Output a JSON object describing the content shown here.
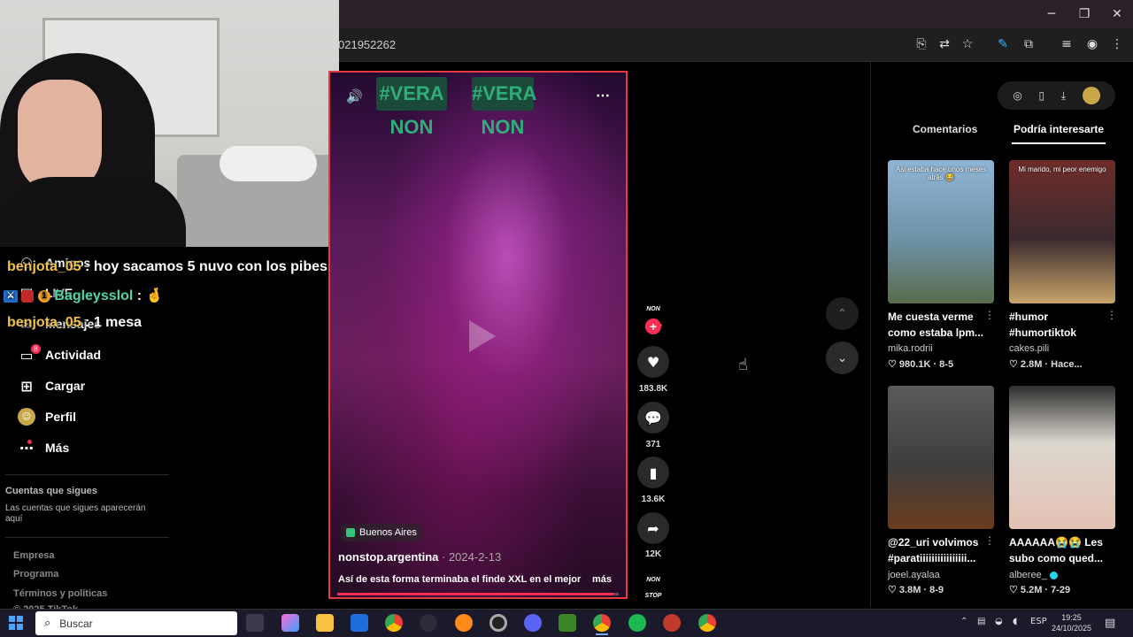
{
  "browser": {
    "url_fragment": "021952262",
    "window_controls": {
      "minimize": "─",
      "restore": "❐",
      "close": "✕"
    }
  },
  "chat_overlay": [
    {
      "user": "benjota_05",
      "sep": " : ",
      "text": "hoy sacamos 5 nuvo con los pibes"
    },
    {
      "user": "Bagleysslol",
      "sep": " : ",
      "text": "🤞"
    },
    {
      "user": "benjota_05",
      "sep": " : ",
      "text": "1 mesa"
    }
  ],
  "sidebar": {
    "items": [
      {
        "label": "Amigos",
        "icon": "friends-icon"
      },
      {
        "label": "LIVE",
        "icon": "live-icon"
      },
      {
        "label": "Mensajes",
        "icon": "messages-icon"
      },
      {
        "label": "Actividad",
        "icon": "activity-icon",
        "badge": "8"
      },
      {
        "label": "Cargar",
        "icon": "upload-icon"
      },
      {
        "label": "Perfil",
        "icon": "profile-icon"
      },
      {
        "label": "Más",
        "icon": "more-icon"
      }
    ],
    "following_title": "Cuentas que sigues",
    "following_empty": "Las cuentas que sigues aparecerán aquí",
    "footer": [
      "Empresa",
      "Programa",
      "Términos y políticas",
      "© 2025 TikTok"
    ]
  },
  "video": {
    "location": "Buenos Aires",
    "author": "nonstop.argentina",
    "date": "2024-2-13",
    "date_sep": " · ",
    "description": "Así de esta forma terminaba el finde XXL en el mejor",
    "more": "más",
    "led_text": "#VERA NON",
    "progress": 0.98,
    "creator_logo": "NON STOP",
    "likes": "183.8K",
    "comments": "371",
    "saves": "13.6K",
    "shares": "12K",
    "music_logo": "NON STOP"
  },
  "right_panel": {
    "tabs": [
      "Comentarios",
      "Podría interesarte"
    ],
    "active_tab": 1,
    "cards": [
      {
        "title": "Me cuesta verme como estaba lpm...",
        "author": "mika.rodrii",
        "stats": "♡ 980.1K · 8-5",
        "caption": "Asi estaba hace unos meses atrás 😂",
        "bg": "#7ba7c9"
      },
      {
        "title": "#humor #humortiktok",
        "author": "cakes.pili",
        "stats": "♡ 2.8M · Hace...",
        "caption": "Mi marido, mi peor enemigo",
        "bg": "#5a3a36"
      },
      {
        "title": "@22_uri volvimos #paratiiiiiiiiiiiiiiii...",
        "author": "joeel.ayalaa",
        "stats": "♡ 3.8M · 8-9",
        "caption": "",
        "bg": "#4a4a4a"
      },
      {
        "title": "AAAAAA😭😭 Les subo como qued...",
        "author": "alberee_",
        "stats": "♡ 5.2M · 7-29",
        "caption": "",
        "bg": "#b9b2a8"
      }
    ]
  },
  "taskbar": {
    "search_placeholder": "Buscar",
    "lang": "ESP",
    "time": "19:25",
    "date": "24/10/2025"
  },
  "colors": {
    "accent": "#fe2c55",
    "frame": "#e63946",
    "chat_user1": "#f0c24b",
    "chat_user2": "#4fd6a6"
  }
}
